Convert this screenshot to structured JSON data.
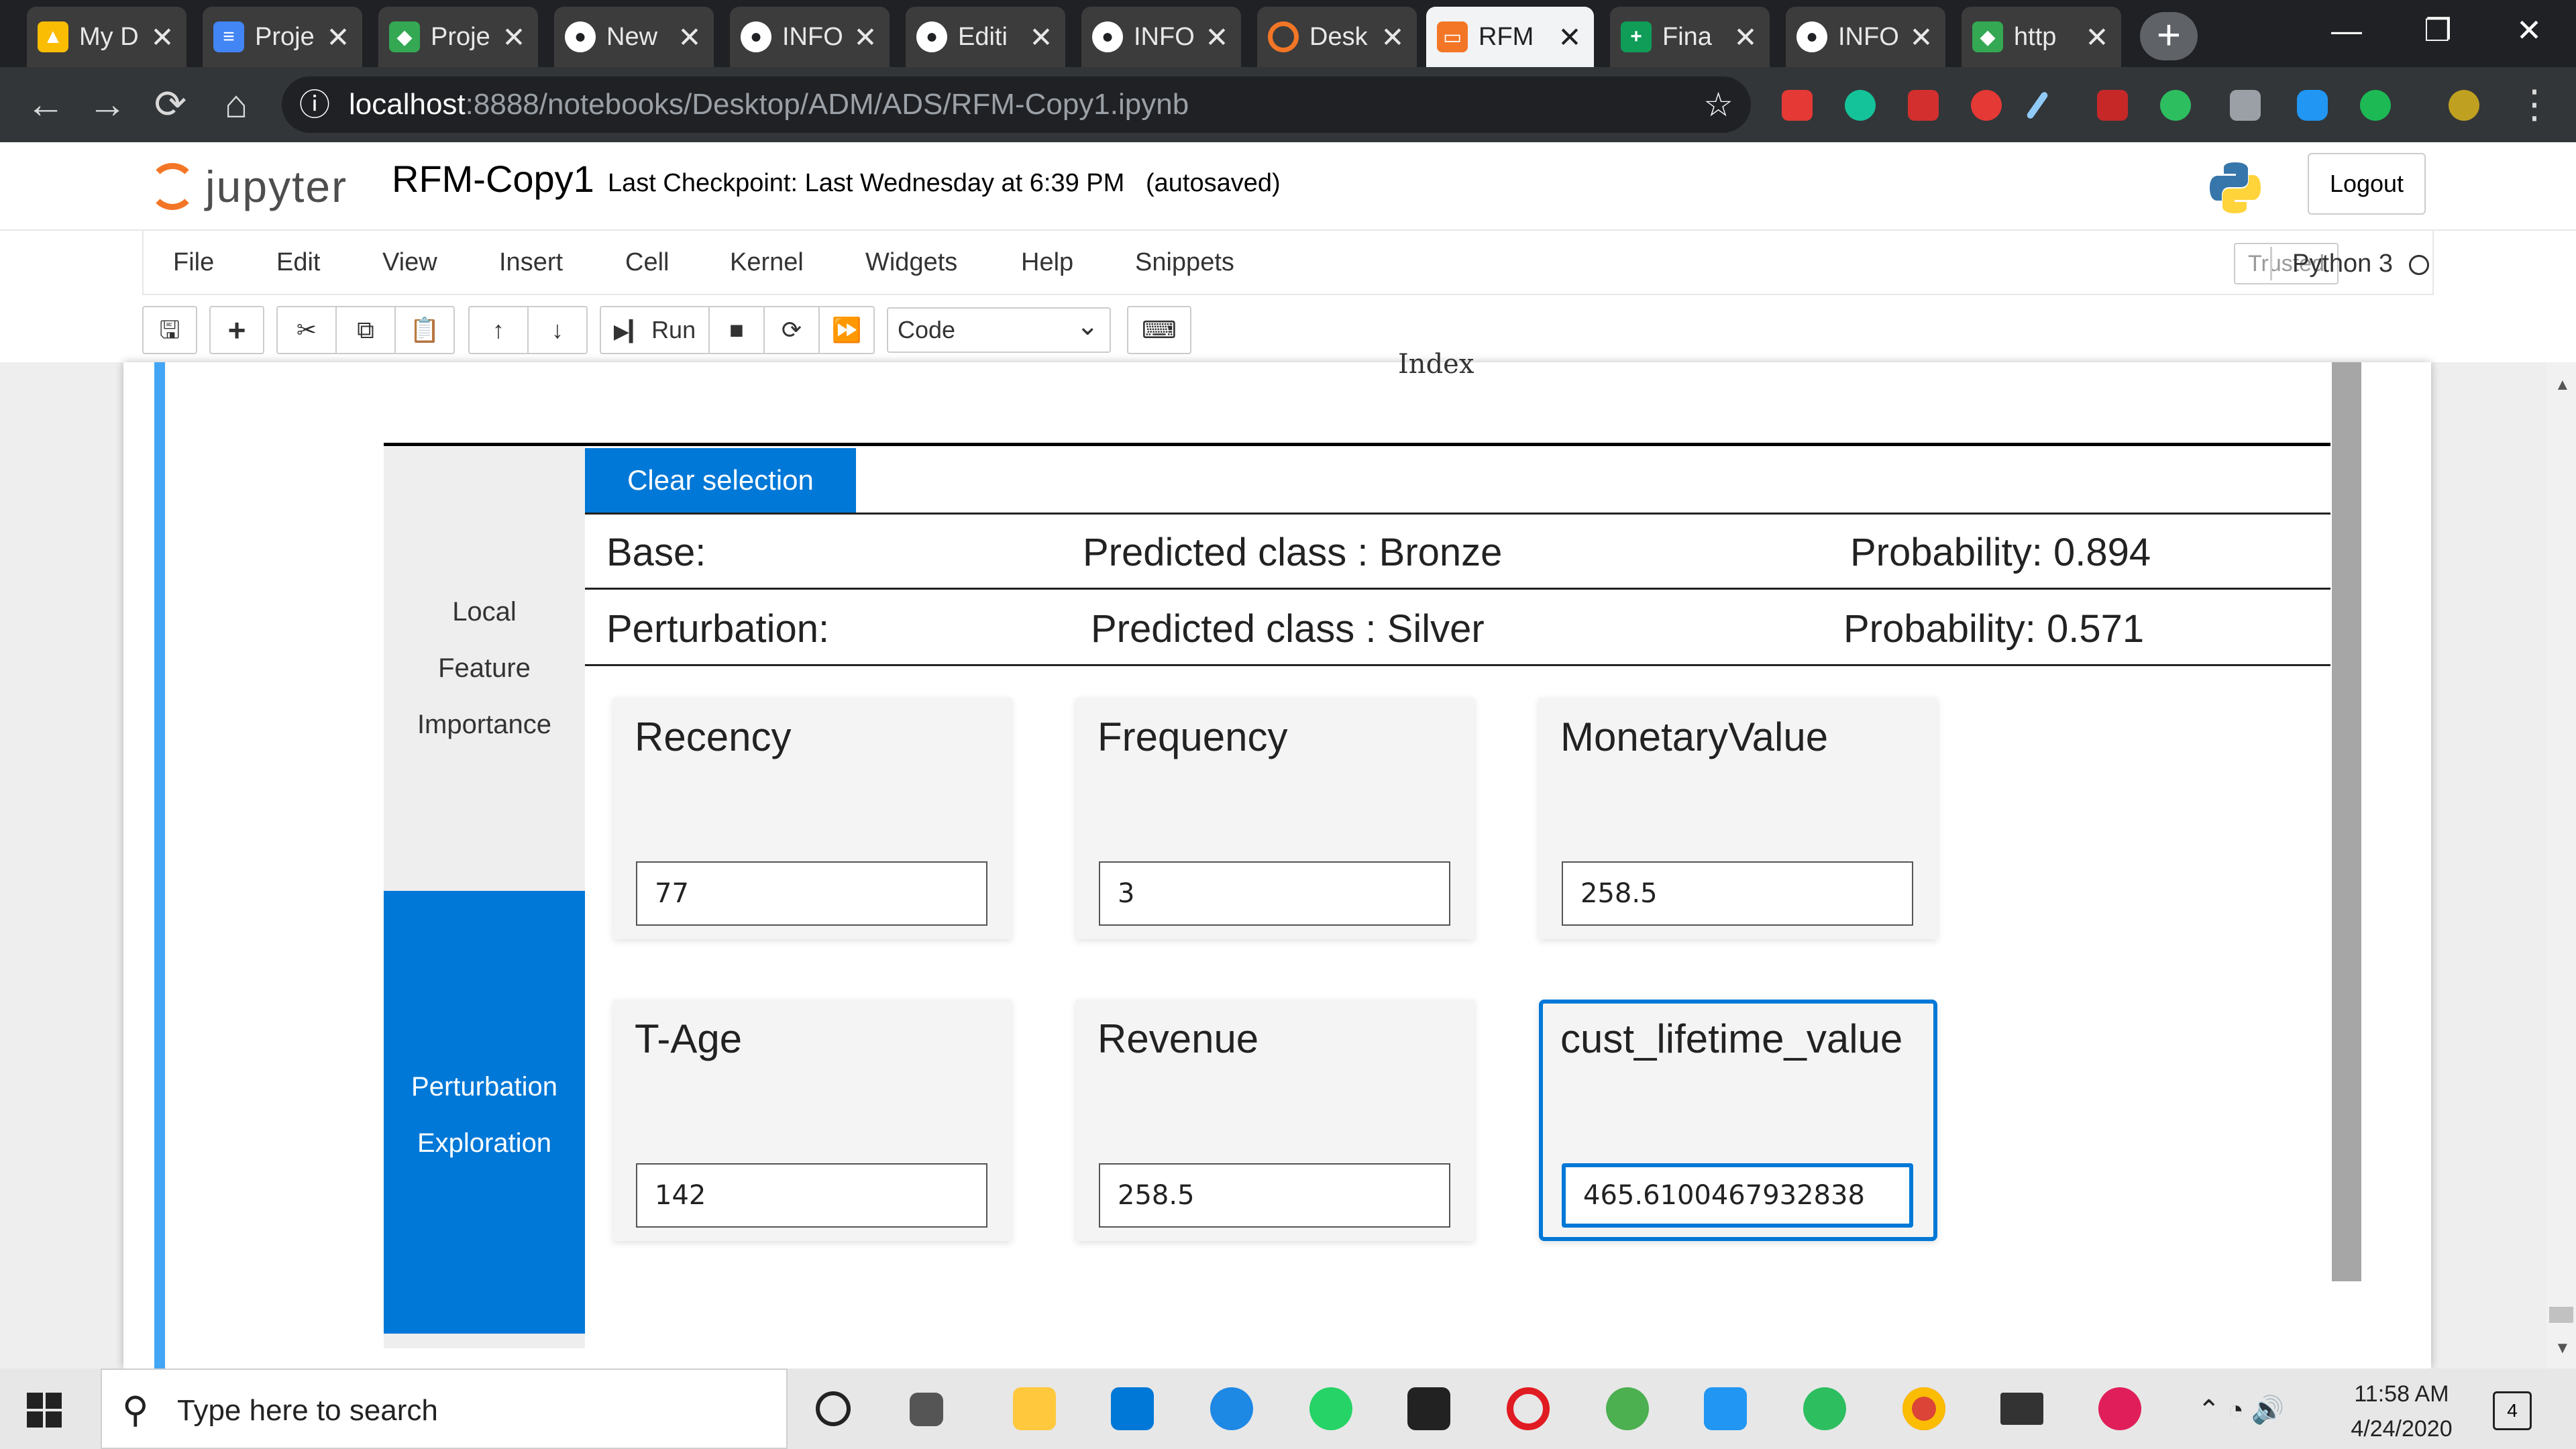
{
  "browser": {
    "tabs": [
      {
        "title": "My D",
        "favicon_color": "#fbbc04",
        "active": false
      },
      {
        "title": "Proje",
        "favicon_color": "#4285f4",
        "active": false
      },
      {
        "title": "Proje",
        "favicon_color": "#34a853",
        "active": false
      },
      {
        "title": "New",
        "favicon_color": "#ffffff",
        "active": false
      },
      {
        "title": "INFO",
        "favicon_color": "#ffffff",
        "active": false
      },
      {
        "title": "Editi",
        "favicon_color": "#ffffff",
        "active": false
      },
      {
        "title": "INFO",
        "favicon_color": "#ffffff",
        "active": false
      },
      {
        "title": "Desk",
        "favicon_color": "#f37626",
        "active": false
      },
      {
        "title": "RFM",
        "favicon_color": "#f37626",
        "active": true
      },
      {
        "title": "Fina",
        "favicon_color": "#0f9d58",
        "active": false
      },
      {
        "title": "INFO",
        "favicon_color": "#ffffff",
        "active": false
      },
      {
        "title": "http",
        "favicon_color": "#34a853",
        "active": false
      }
    ],
    "tab_close_glyph": "✕",
    "new_tab_glyph": "+",
    "window_controls": {
      "minimize": "—",
      "restore": "❐",
      "close": "✕"
    },
    "url_host": "localhost",
    "url_path": ":8888/notebooks/Desktop/ADM/ADS/RFM-Copy1.ipynb",
    "nav": {
      "back": "←",
      "forward": "→",
      "reload": "⟳",
      "home": "⌂",
      "info": "ⓘ",
      "star": "☆",
      "menu": "⋮"
    }
  },
  "jupyter": {
    "logo_text": "jupyter",
    "notebook_name": "RFM-Copy1",
    "checkpoint": "Last Checkpoint: Last Wednesday at 6:39 PM",
    "autosave": "(autosaved)",
    "logout_label": "Logout",
    "menu": [
      "File",
      "Edit",
      "View",
      "Insert",
      "Cell",
      "Kernel",
      "Widgets",
      "Help",
      "Snippets"
    ],
    "trusted_label": "Trusted",
    "kernel_label": "Python 3",
    "toolbar": {
      "save": "🖫",
      "add": "+",
      "cut": "✂",
      "copy": "⧉",
      "paste": "📋",
      "up": "↑",
      "down": "↓",
      "run_label": "Run",
      "run_icon": "▶▎",
      "stop": "■",
      "restart": "⟳",
      "fast_forward": "⏩",
      "keyboard": "⌨",
      "cell_type": "Code",
      "dropdown": "⌄"
    }
  },
  "widget": {
    "axis_label_fragment": "Index",
    "sidebar": {
      "local_lines": [
        "Local",
        "Feature",
        "Importance"
      ],
      "perturbation_lines": [
        "Perturbation",
        "Exploration"
      ]
    },
    "clear_selection_label": "Clear selection",
    "base": {
      "label": "Base:",
      "predicted": "Predicted class : Bronze",
      "probability": "Probability: 0.894"
    },
    "perturbation": {
      "label": "Perturbation:",
      "predicted": "Predicted class : Silver",
      "probability": "Probability: 0.571"
    },
    "features": [
      {
        "name": "Recency",
        "value": "77"
      },
      {
        "name": "Frequency",
        "value": "3"
      },
      {
        "name": "MonetaryValue",
        "value": "258.5"
      },
      {
        "name": "T-Age",
        "value": "142"
      },
      {
        "name": "Revenue",
        "value": "258.5"
      },
      {
        "name": "cust_lifetime_value",
        "value": "465.6100467932838"
      }
    ],
    "accent_color": "#0078d7"
  },
  "taskbar": {
    "search_placeholder": "Type here to search",
    "search_icon": "⚲",
    "time": "11:58 AM",
    "date": "4/24/2020",
    "notification_count": "4",
    "tray": "⌃  ◔  🔊"
  }
}
